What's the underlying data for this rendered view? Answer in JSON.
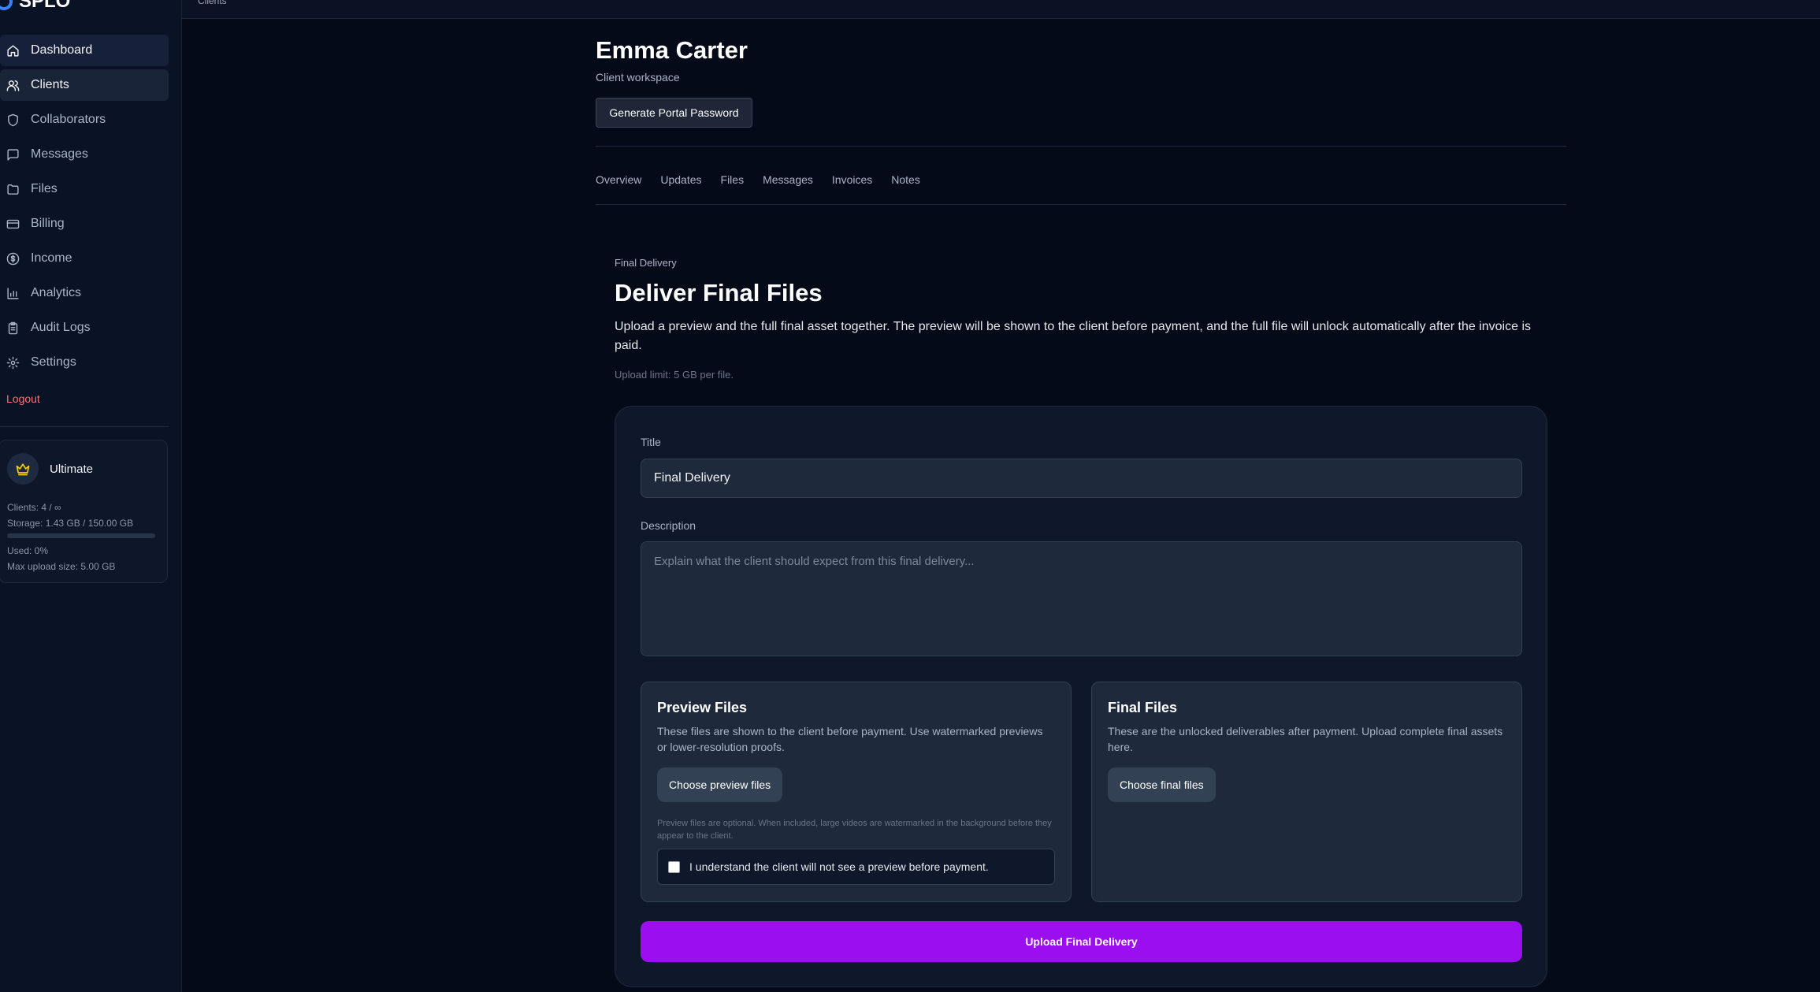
{
  "app": {
    "brand": "SPLO"
  },
  "topbar": {
    "breadcrumb": "Clients"
  },
  "sidebar": {
    "items": [
      {
        "label": "Dashboard",
        "icon": "home-icon",
        "state": "hover"
      },
      {
        "label": "Clients",
        "icon": "users-icon",
        "state": "active"
      },
      {
        "label": "Collaborators",
        "icon": "shield-icon",
        "state": ""
      },
      {
        "label": "Messages",
        "icon": "message-icon",
        "state": ""
      },
      {
        "label": "Files",
        "icon": "folder-icon",
        "state": ""
      },
      {
        "label": "Billing",
        "icon": "credit-card-icon",
        "state": ""
      },
      {
        "label": "Income",
        "icon": "dollar-circle-icon",
        "state": ""
      },
      {
        "label": "Analytics",
        "icon": "bar-chart-icon",
        "state": ""
      },
      {
        "label": "Audit Logs",
        "icon": "clipboard-icon",
        "state": ""
      },
      {
        "label": "Settings",
        "icon": "gear-icon",
        "state": ""
      }
    ],
    "logout": "Logout",
    "plan": {
      "name": "Ultimate",
      "clients": "Clients: 4 / ∞",
      "storage": "Storage: 1.43 GB / 150.00 GB",
      "used": "Used: 0%",
      "used_fraction": 0,
      "max_upload": "Max upload size: 5.00 GB"
    }
  },
  "client": {
    "name": "Emma Carter",
    "subtitle": "Client workspace",
    "portal_button": "Generate Portal Password"
  },
  "tabs": [
    "Overview",
    "Updates",
    "Files",
    "Messages",
    "Invoices",
    "Notes"
  ],
  "delivery": {
    "eyebrow": "Final Delivery",
    "heading": "Deliver Final Files",
    "intro": "Upload a preview and the full final asset together. The preview will be shown to the client before payment, and the full file will unlock automatically after the invoice is paid.",
    "limit": "Upload limit: 5 GB per file.",
    "title_label": "Title",
    "title_value": "Final Delivery",
    "description_label": "Description",
    "description_placeholder": "Explain what the client should expect from this final delivery...",
    "preview": {
      "title": "Preview Files",
      "desc": "These files are shown to the client before payment. Use watermarked previews or lower-resolution proofs.",
      "button": "Choose preview files",
      "note": "Preview files are optional. When included, large videos are watermarked in the background before they appear to the client.",
      "ack": "I understand the client will not see a preview before payment."
    },
    "final": {
      "title": "Final Files",
      "desc": "These are the unlocked deliverables after payment. Upload complete final assets here.",
      "button": "Choose final files"
    },
    "submit": "Upload Final Delivery"
  },
  "colors": {
    "accent": "#9b0ef0",
    "logout": "#f87171",
    "crown": "#facc15"
  }
}
